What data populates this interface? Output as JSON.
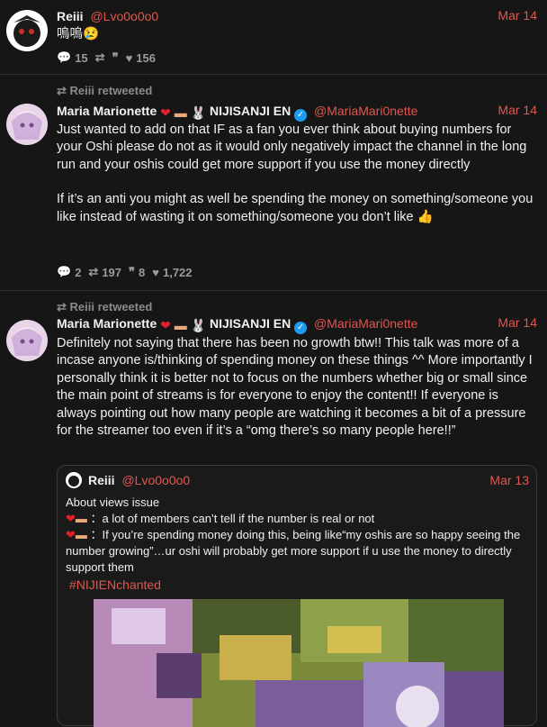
{
  "tweets": [
    {
      "name": "Reiii",
      "handle": "@Lvo0o0o0",
      "date": "Mar 14",
      "text": "嗚嗚😢",
      "replies": "15",
      "retweets": "",
      "quotes": "",
      "likes": "156"
    },
    {
      "retweeted_by": "Reiii retweeted",
      "name": "Maria Marionette",
      "badge": "NIJISANJI EN",
      "handle": "@MariaMari0nette",
      "date": "Mar 14",
      "text_1": "Just wanted to add on that IF as a fan you ever think about buying numbers for your Oshi please do not as it would only negatively impact the channel in the long run and your oshis could get more support if you use the money directly",
      "text_2": "If it’s an anti you might as well be spending the money on something/someone you like instead of wasting it on something/someone you don’t like",
      "replies": "2",
      "retweets": "197",
      "quotes": "8",
      "likes": "1,722"
    },
    {
      "retweeted_by": "Reiii retweeted",
      "name": "Maria Marionette",
      "badge": "NIJISANJI EN",
      "handle": "@MariaMari0nette",
      "date": "Mar 14",
      "text": "Definitely not saying that there has been no growth btw!! This talk was more of a incase anyone is/thinking of spending money on these things ^^ More importantly I personally think it is better not to focus on the numbers whether big or small since the main point of streams is for everyone to enjoy the content!! If everyone is always pointing out how many people are watching it becomes a bit of a pressure for the streamer too even if it’s a “omg there’s so many people here!!”"
    }
  ],
  "quote": {
    "name": "Reiii",
    "handle": "@Lvo0o0o0",
    "date": "Mar 13",
    "line_1": "About views issue",
    "line_2": "：a lot of members can’t tell if the number is real or not",
    "line_3": "：If you’re spending money doing this, being like“my oshis are so happy seeing the number growing”…ur oshi will probably get more support if u use the money to directly support them",
    "hashtag": "#NIJIENchanted"
  },
  "colors": {
    "accent": "#e0574f",
    "background": "#161616",
    "verified": "#1d9bf0"
  }
}
